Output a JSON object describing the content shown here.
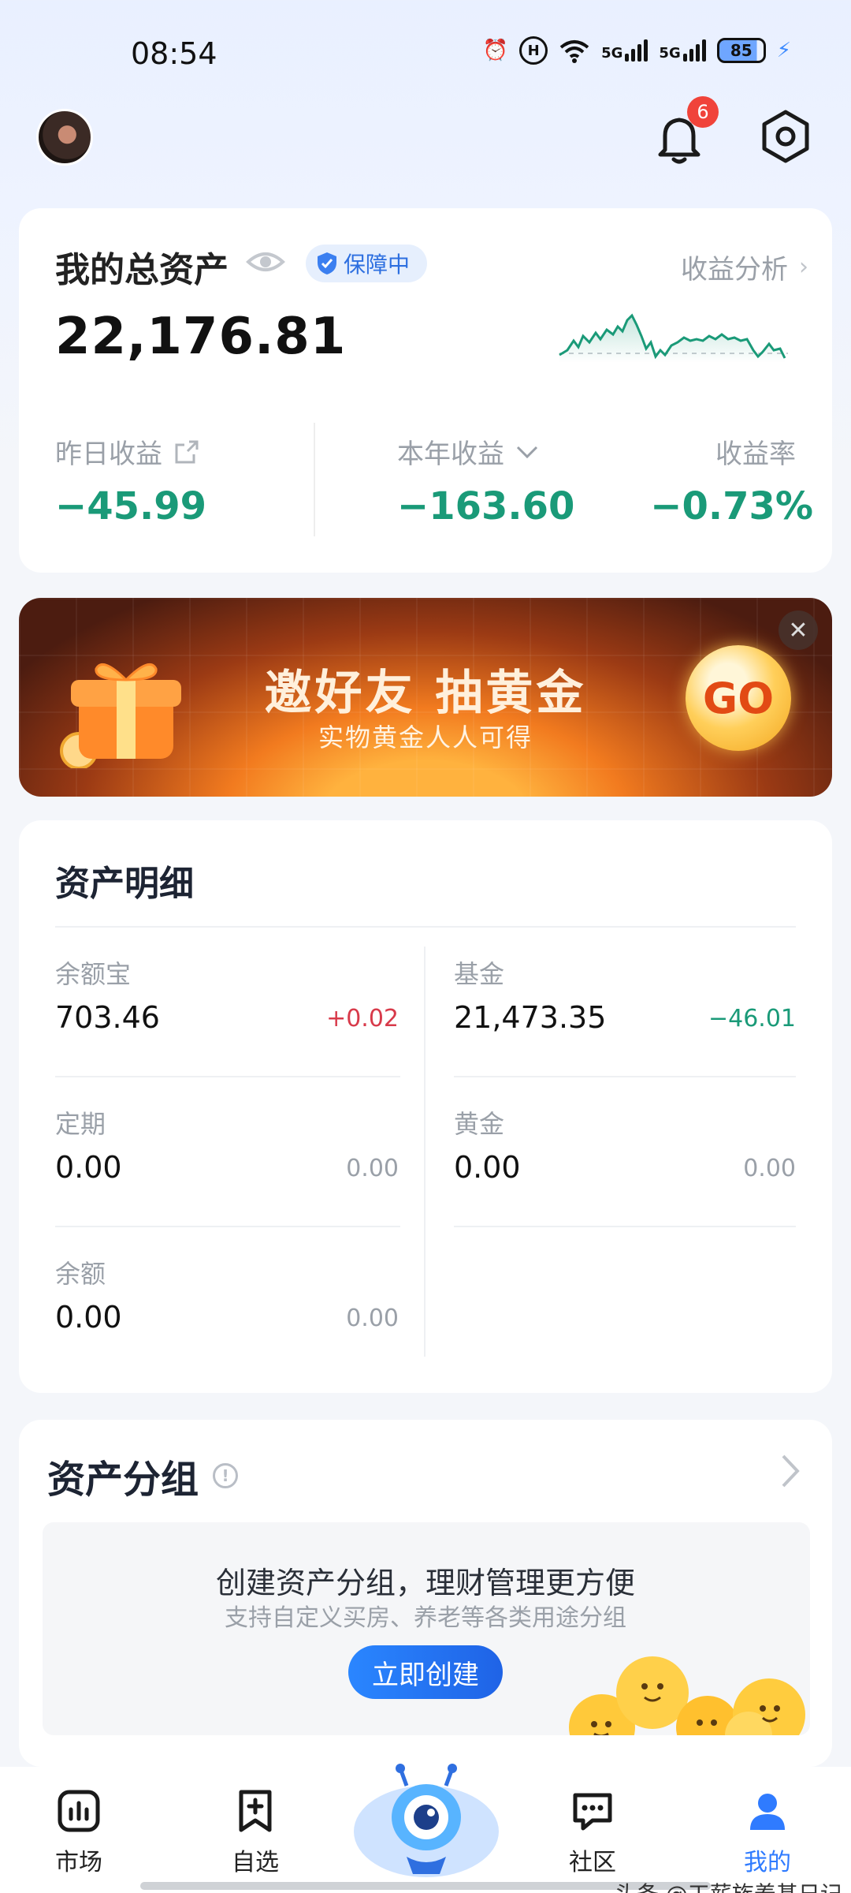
{
  "status_bar": {
    "time": "08:54",
    "network_1": "5G",
    "network_2": "5G",
    "battery": "85"
  },
  "header": {
    "notification_count": "6"
  },
  "total_assets": {
    "label": "我的总资产",
    "protection_badge": "保障中",
    "analysis_link": "收益分析",
    "value": "22,176.81",
    "stats": [
      {
        "label": "昨日收益",
        "value": "−45.99"
      },
      {
        "label": "本年收益",
        "value": "−163.60"
      },
      {
        "label": "收益率",
        "value": "−0.73%"
      }
    ]
  },
  "banner": {
    "title": "邀好友 抽黄金",
    "subtitle": "实物黄金人人可得",
    "go_label": "GO",
    "close": "✕"
  },
  "asset_detail": {
    "title": "资产明细",
    "items": [
      {
        "label": "余额宝",
        "value": "703.46",
        "change": "+0.02"
      },
      {
        "label": "基金",
        "value": "21,473.35",
        "change": "−46.01"
      },
      {
        "label": "定期",
        "value": "0.00",
        "change": "0.00"
      },
      {
        "label": "黄金",
        "value": "0.00",
        "change": "0.00"
      },
      {
        "label": "余额",
        "value": "0.00",
        "change": "0.00"
      }
    ]
  },
  "asset_group": {
    "title": "资产分组",
    "headline": "创建资产分组，理财管理更方便",
    "subline": "支持自定义买房、养老等各类用途分组",
    "create_button": "立即创建"
  },
  "bottom_nav": {
    "items": [
      {
        "label": "市场"
      },
      {
        "label": "自选"
      },
      {
        "label": "社区"
      },
      {
        "label": "我的"
      }
    ]
  },
  "watermark": "头条 @工薪族养基日记",
  "colors": {
    "negative": "#1a9a78",
    "positive": "#d83a4a",
    "accent": "#2a86ff"
  }
}
